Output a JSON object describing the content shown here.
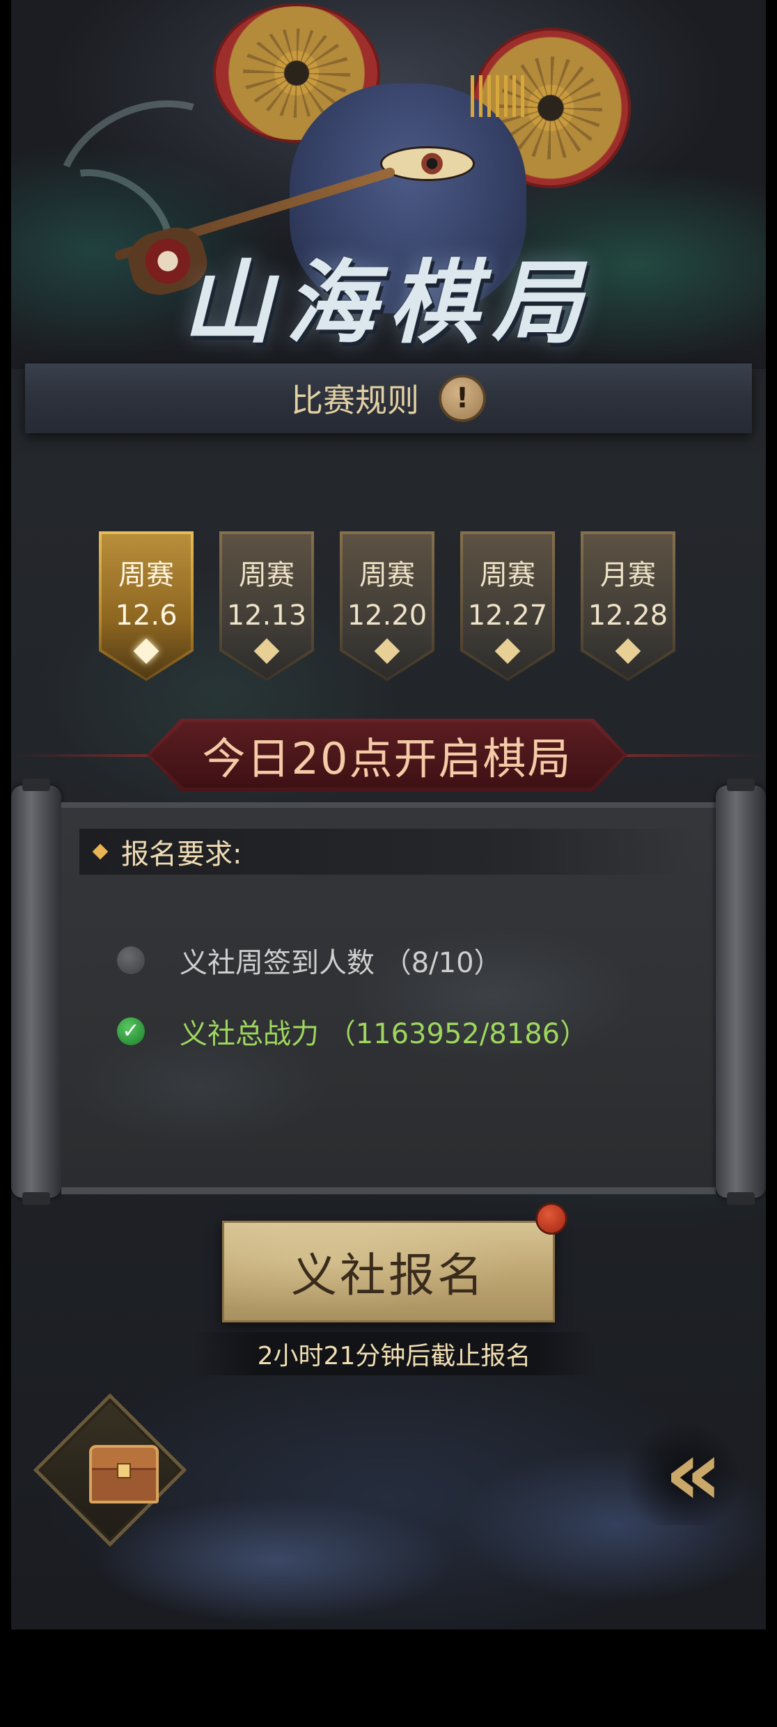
{
  "banner": {
    "game_title": "山海棋局"
  },
  "rules": {
    "label": "比赛规则",
    "info_icon": "exclamation-icon",
    "info_glyph": "!"
  },
  "schedule": {
    "tabs": [
      {
        "type": "周赛",
        "date": "12.6",
        "active": true
      },
      {
        "type": "周赛",
        "date": "12.13",
        "active": false
      },
      {
        "type": "周赛",
        "date": "12.20",
        "active": false
      },
      {
        "type": "周赛",
        "date": "12.27",
        "active": false
      },
      {
        "type": "月赛",
        "date": "12.28",
        "active": false
      }
    ]
  },
  "announcement": {
    "text": "今日20点开启棋局"
  },
  "requirements": {
    "title": "报名要求:",
    "items": [
      {
        "text": "义社周签到人数 （8/10）",
        "status": "pending"
      },
      {
        "text": "义社总战力 （1163952/8186）",
        "status": "done",
        "check_glyph": "✓"
      }
    ]
  },
  "signup": {
    "label": "义社报名",
    "deadline": "2小时21分钟后截止报名"
  },
  "bottom": {
    "chest_icon": "treasure-chest-icon",
    "back_icon": "double-chevron-left-icon",
    "back_glyph": "«"
  },
  "colors": {
    "gold": "#e7bd58",
    "accent_red": "#6a2327",
    "done_green": "#9ed75d"
  }
}
